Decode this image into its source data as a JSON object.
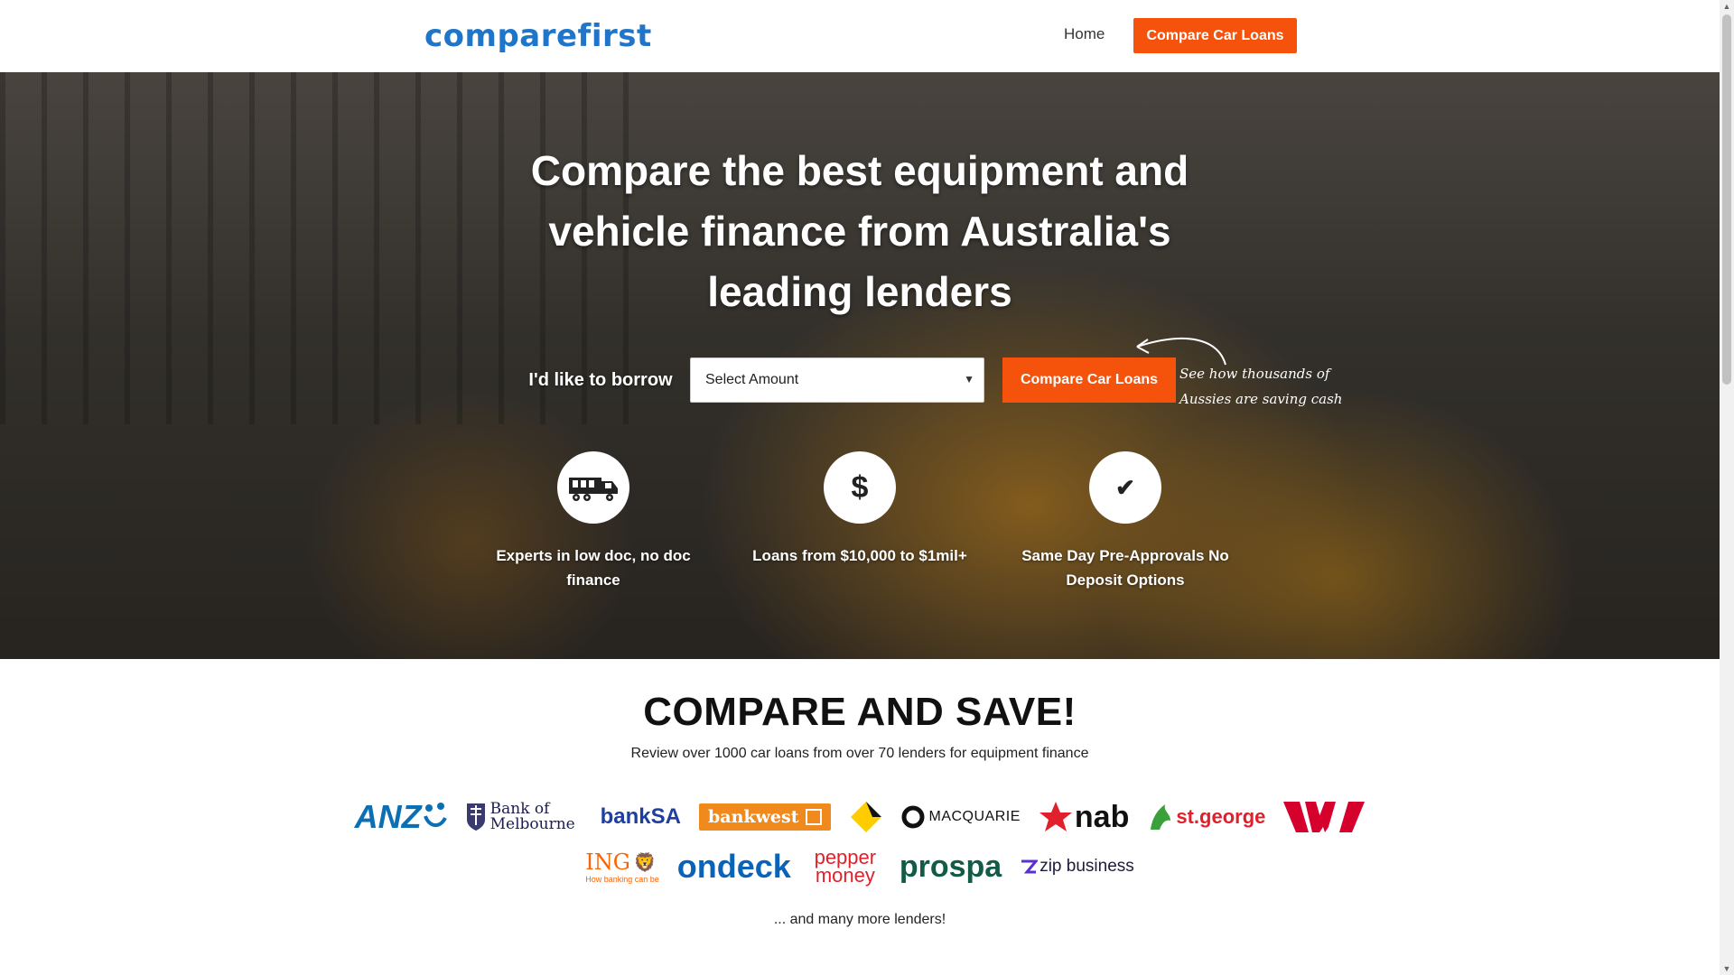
{
  "header": {
    "logo_text": "comparefirst",
    "nav_home": "Home",
    "nav_cta": "Compare Car Loans"
  },
  "hero": {
    "title": "Compare the best equipment and vehicle finance from Australia's leading lenders",
    "borrow_label": "I'd like to borrow",
    "amount_select": {
      "value": "Select Amount"
    },
    "cta": "Compare Car Loans",
    "handwritten_note": "See how thousands of Aussies are saving cash",
    "features": [
      {
        "icon": "truck-icon",
        "text": "Experts in low doc, no doc finance"
      },
      {
        "icon": "dollar-icon",
        "text": "Loans from $10,000 to $1mil+"
      },
      {
        "icon": "checkmark-icon",
        "text": "Same Day Pre-Approvals No Deposit Options"
      }
    ]
  },
  "compare": {
    "title": "COMPARE AND SAVE!",
    "subtitle": "Review over 1000 car loans from over 70 lenders for equipment finance",
    "lenders_row1": [
      "ANZ",
      "Bank of Melbourne",
      "bankSA",
      "bankwest",
      "Commonwealth Bank",
      "MACQUARIE",
      "nab",
      "st.george",
      "Westpac"
    ],
    "lenders_row2": [
      "ING",
      "ondeck",
      "pepper money",
      "prospa",
      "zip business"
    ],
    "ing_tagline": "How banking can be",
    "more": "... and many more lenders!"
  },
  "colors": {
    "accent": "#f5520c",
    "logo_blue": "#1f75c9"
  }
}
